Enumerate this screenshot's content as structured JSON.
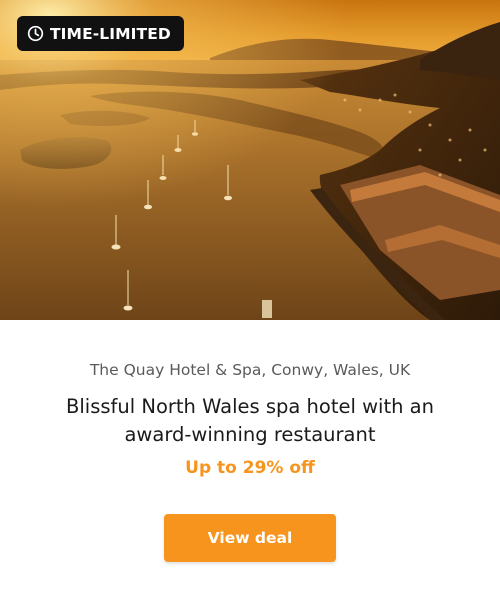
{
  "hero": {
    "image_alt": "Aerial sunset view of Conwy estuary with moored sailboats and a waterfront hotel",
    "badge": {
      "icon": "clock-icon",
      "label": "TIME-LIMITED"
    }
  },
  "offer": {
    "location": "The Quay Hotel & Spa, Conwy, Wales, UK",
    "title": "Blissful North Wales spa hotel with an award-winning restaurant",
    "discount": "Up to 29% off",
    "cta_label": "View deal"
  },
  "colors": {
    "accent": "#f7941d",
    "badge_bg": "#111111",
    "title_text": "#1a1a1a",
    "muted_text": "#5a5a5a"
  }
}
